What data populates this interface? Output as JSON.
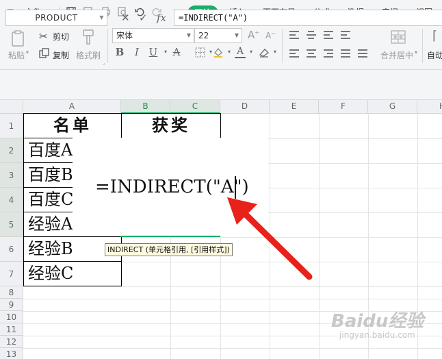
{
  "menubar": {
    "file_label": "文件",
    "tabs": [
      {
        "label": "开始",
        "active": true
      },
      {
        "label": "插入"
      },
      {
        "label": "页面布局"
      },
      {
        "label": "公式"
      },
      {
        "label": "数据"
      },
      {
        "label": "审阅"
      },
      {
        "label": "视图"
      }
    ],
    "accent_color": "#1aad68"
  },
  "ribbon": {
    "paste_label": "粘贴",
    "cut_label": "剪切",
    "copy_label": "复制",
    "format_painter_label": "格式刷",
    "font_name": "宋体",
    "font_size": "22",
    "merge_label": "合并居中",
    "autowrap_label": "自动"
  },
  "formula_bar": {
    "name_box": "PRODUCT",
    "formula": "=INDIRECT(\"A\")"
  },
  "sheet": {
    "columns": [
      "A",
      "B",
      "C",
      "D",
      "E",
      "F",
      "G",
      "H"
    ],
    "rows": [
      "1",
      "2",
      "3",
      "4",
      "5",
      "6",
      "7",
      "8",
      "9",
      "10",
      "11",
      "12",
      "13"
    ],
    "header_a": "名单",
    "header_bc": "获奖",
    "a2": "百度A",
    "a3": "百度B",
    "a4": "百度C",
    "a5": "经验A",
    "a6": "经验B",
    "a7": "经验C",
    "edit_text": "=INDIRECT(\"A\")",
    "tooltip": "INDIRECT (单元格引用, [引用样式])"
  },
  "watermark": {
    "brand": "Baidu经验",
    "url": "jingyan.baidu.com"
  }
}
